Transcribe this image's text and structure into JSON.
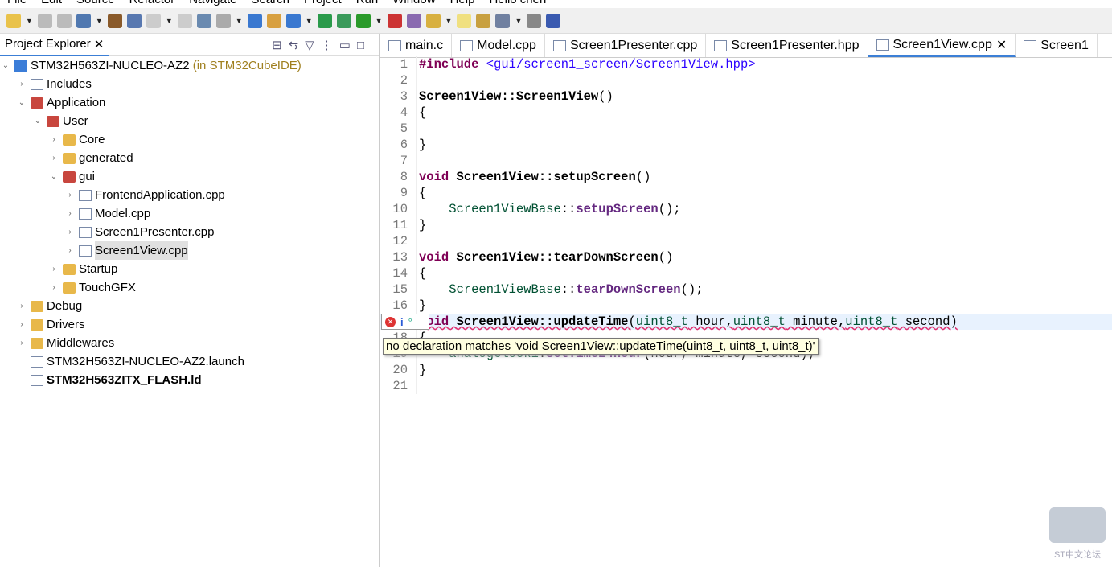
{
  "menu": [
    "File",
    "Edit",
    "Source",
    "Refactor",
    "Navigate",
    "Search",
    "Project",
    "Run",
    "Window",
    "Help",
    "Hello chen"
  ],
  "explorer": {
    "title": "Project Explorer",
    "project": "STM32H563ZI-NUCLEO-AZ2",
    "project_suffix": "(in STM32CubeIDE)",
    "items": [
      {
        "label": "Includes",
        "depth": 1,
        "icon": "includes",
        "arrow": "›"
      },
      {
        "label": "Application",
        "depth": 1,
        "icon": "pkg",
        "arrow": "⌄"
      },
      {
        "label": "User",
        "depth": 2,
        "icon": "pkg",
        "arrow": "⌄"
      },
      {
        "label": "Core",
        "depth": 3,
        "icon": "folder",
        "arrow": "›"
      },
      {
        "label": "generated",
        "depth": 3,
        "icon": "folder",
        "arrow": "›"
      },
      {
        "label": "gui",
        "depth": 3,
        "icon": "pkg",
        "arrow": "⌄"
      },
      {
        "label": "FrontendApplication.cpp",
        "depth": 4,
        "icon": "file",
        "arrow": "›"
      },
      {
        "label": "Model.cpp",
        "depth": 4,
        "icon": "file",
        "arrow": "›"
      },
      {
        "label": "Screen1Presenter.cpp",
        "depth": 4,
        "icon": "file",
        "arrow": "›"
      },
      {
        "label": "Screen1View.cpp",
        "depth": 4,
        "icon": "file",
        "arrow": "›",
        "selected": true
      },
      {
        "label": "Startup",
        "depth": 3,
        "icon": "folder",
        "arrow": "›"
      },
      {
        "label": "TouchGFX",
        "depth": 3,
        "icon": "folder",
        "arrow": "›"
      },
      {
        "label": "Debug",
        "depth": 1,
        "icon": "folder",
        "arrow": "›"
      },
      {
        "label": "Drivers",
        "depth": 1,
        "icon": "folder",
        "arrow": "›"
      },
      {
        "label": "Middlewares",
        "depth": 1,
        "icon": "folder",
        "arrow": "›"
      },
      {
        "label": "STM32H563ZI-NUCLEO-AZ2.launch",
        "depth": 1,
        "icon": "file",
        "arrow": ""
      },
      {
        "label": "STM32H563ZITX_FLASH.ld",
        "depth": 1,
        "icon": "file",
        "arrow": "",
        "bold": true
      }
    ]
  },
  "tabs": [
    "main.c",
    "Model.cpp",
    "Screen1Presenter.cpp",
    "Screen1Presenter.hpp",
    "Screen1View.cpp",
    "Screen1"
  ],
  "active_tab": 4,
  "code": [
    "<span class='kw'>#include</span> <span class='str'>&lt;gui/screen1_screen/Screen1View.hpp&gt;</span>",
    "",
    "<span class='b'>Screen1View::Screen1View</span>()",
    "{",
    "",
    "}",
    "",
    "<span class='kw'>void</span> <span class='b'>Screen1View::setupScreen</span>()",
    "{",
    "    <span class='ty'>Screen1ViewBase</span>::<span class='fn'>setupScreen</span>();",
    "}",
    "",
    "<span class='kw'>void</span> <span class='b'>Screen1View::tearDownScreen</span>()",
    "{",
    "    <span class='ty'>Screen1ViewBase</span>::<span class='fn'>tearDownScreen</span>();",
    "}",
    "<span class='err'><span class='kw'>void</span> <span class='b'>Screen1View::updateTime</span>(<span class='ty'>uint8_t</span> hour,<span class='ty'>uint8_t</span> minute,<span class='ty'>uint8_t</span> second)</span>",
    "{",
    "    <span class='ty'>analogClock1</span>.<span class='fn'>setTime24Hour</span>(hour, minute, second);",
    "}",
    ""
  ],
  "tooltip": "no declaration matches 'void Screen1View::updateTime(uint8_t, uint8_t, uint8_t)'",
  "watermark": "ST中文论坛"
}
